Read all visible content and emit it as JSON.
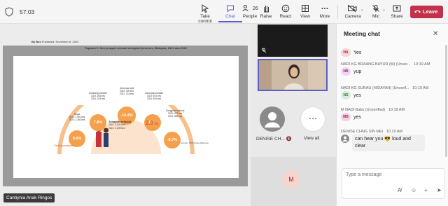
{
  "meeting": {
    "elapsed": "57:03"
  },
  "toolbar": {
    "take_control": "Take control",
    "chat": "Chat",
    "people": "People",
    "people_count": "26",
    "raise": "Raise",
    "react": "React",
    "view": "View",
    "more": "More",
    "camera": "Camera",
    "mic": "Mic",
    "share": "Share",
    "leave": "Leave"
  },
  "stage": {
    "presenter_name": "Cantiynia Anak Ringos",
    "slide": {
      "byline_author": "By Bss",
      "byline_date": "Published: November 6, 2023",
      "title": "Paparan 2: Kes jenayah seksual mengikut jenis kes, Malaysia, 2021 dan 2022",
      "items": [
        {
          "label": "Rogol",
          "detail": "2022: 1,491 kes\n2021: 1,360 kes",
          "pct": "9.6%"
        },
        {
          "label": "Sumbang mahram",
          "detail": "2022: 264 kes\n2021: 243 kes",
          "pct": "7.8%"
        },
        {
          "label": "Jenis luar tabii",
          "detail": "2022: 199 kes\n2021: 223 kes",
          "pct": "-10.4%"
        },
        {
          "label": "Cabul kehormatan",
          "detail": "2022: 872 kes\n2021: 874 kes",
          "pct": "-0.2%"
        },
        {
          "label": "Gangguan seksual",
          "detail": "2022: 477 kes\n2021: 506 kes",
          "pct": "-5.7%"
        }
      ],
      "main_label": "Jenayah seksual",
      "main_detail": "2022: 3,303 kes\n2021: 3,209 kes",
      "main_pct": "2.9%",
      "tag": "Peratus perubahan",
      "source": "Sumber: PDB Diraja Malaysia"
    }
  },
  "participants": {
    "tile_denise": "DENISE CH...",
    "view_all": "View all",
    "self_initial": "M"
  },
  "chat": {
    "title": "Meeting chat",
    "messages": [
      {
        "sender": "",
        "time": "",
        "initials": "HA",
        "text": "Yes",
        "avatar_bg": "#f6d6d6",
        "avatar_fg": "#a4262c"
      },
      {
        "sender": "NADI KG BRAANG BAYUR (M) (Unver...",
        "time": "10:19 AM",
        "initials": "NB",
        "text": "yup",
        "avatar_bg": "#f2d6ef",
        "avatar_fg": "#8b2d86"
      },
      {
        "sender": "NADI KG SURAU (HIDAYAH) (Unverif...",
        "time": "10:19 AM",
        "initials": "NS",
        "text": "yes",
        "avatar_bg": "#d4eedc",
        "avatar_fg": "#2e7d32"
      },
      {
        "sender": "M NADI Bako (Unverified)",
        "time": "10:19 AM",
        "initials": "MB",
        "text": "yes",
        "avatar_bg": "#f3d2e4",
        "avatar_fg": "#a8266b"
      },
      {
        "sender": "DENISE CHNG SIN MEI",
        "time": "10:19 AM",
        "initials": "",
        "text": "can hear you 😎 loud and clear",
        "avatar_bg": "#8a8a8a",
        "avatar_fg": "#ffffff"
      }
    ],
    "composer_placeholder": "Type a message"
  },
  "colors": {
    "accent": "#5b5fc7",
    "leave": "#c4314b",
    "slide_orange": "#f5a04a"
  }
}
